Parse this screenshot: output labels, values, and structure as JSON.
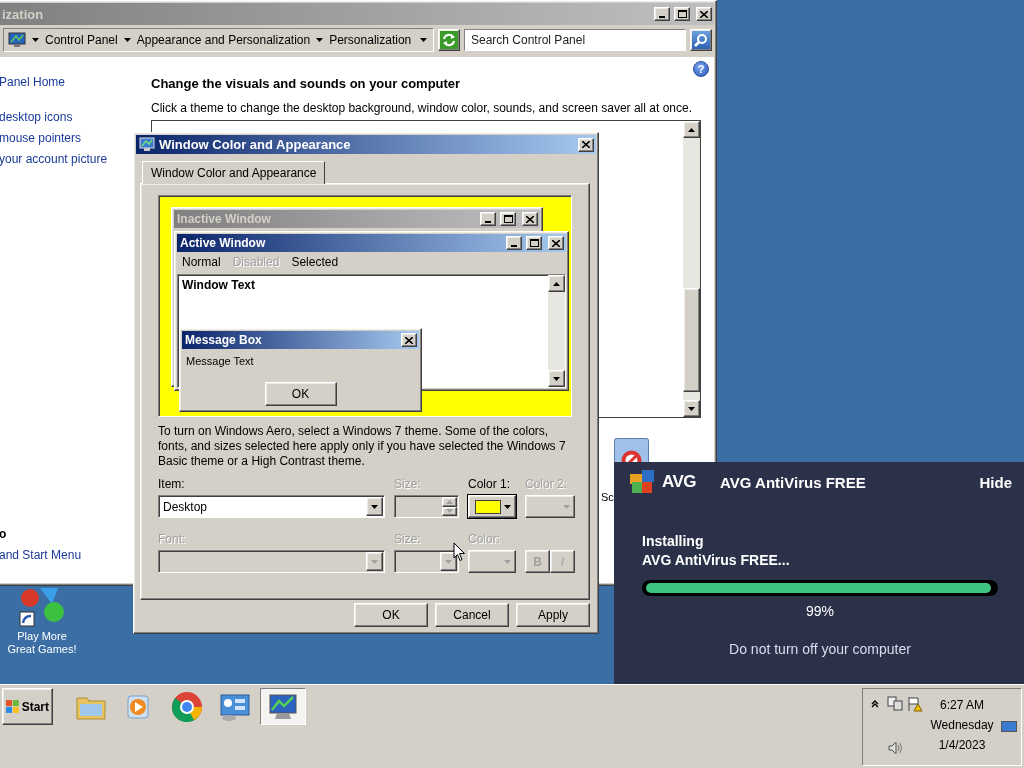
{
  "control_panel": {
    "title": "ization",
    "breadcrumbs": [
      "Control Panel",
      "Appearance and Personalization",
      "Personalization"
    ],
    "search": {
      "placeholder": "Search Control Panel"
    },
    "help": "?",
    "tasks": [
      {
        "label": "Panel Home",
        "kind": "home"
      },
      {
        "label": "desktop icons",
        "kind": "task"
      },
      {
        "label": "mouse pointers",
        "kind": "task"
      },
      {
        "label": "your account picture",
        "kind": "task"
      }
    ],
    "see_also": {
      "title": "o",
      "links": [
        "and Start Menu"
      ]
    },
    "heading": "Change the visuals and sounds on your computer",
    "description": "Click a theme to change the desktop background, window color, sounds, and screen saver all at once.",
    "screen_saver_label": "Sc"
  },
  "dialog": {
    "title": "Window Color and Appearance",
    "tabs": [
      {
        "label": "Window Color and Appearance",
        "selected": true
      }
    ],
    "preview": {
      "inactive_title": "Inactive Window",
      "active_title": "Active Window",
      "menu": [
        {
          "label": "Normal",
          "disabled": false
        },
        {
          "label": "Disabled",
          "disabled": true
        },
        {
          "label": "Selected",
          "disabled": false
        }
      ],
      "window_text": "Window Text",
      "message_box": {
        "title": "Message Box",
        "text": "Message Text",
        "button": "OK"
      }
    },
    "note": "To turn on Windows Aero, select a Windows 7 theme.  Some of the colors, fonts, and sizes selected here apply only if you have selected the Windows 7 Basic theme or a High Contrast theme.",
    "rows": [
      [
        {
          "label": "Item:",
          "kind": "select",
          "value": "Desktop",
          "disabled": false
        },
        {
          "label": "Size:",
          "kind": "spinner",
          "disabled": true
        },
        {
          "label": "Color 1:",
          "kind": "color",
          "disabled": false,
          "color": "#ffff00"
        },
        {
          "label": "Color 2:",
          "kind": "color",
          "disabled": true
        }
      ],
      [
        {
          "label": "Font:",
          "kind": "select",
          "disabled": true
        },
        {
          "label": "Size:",
          "kind": "select",
          "disabled": true
        },
        {
          "label": "Color:",
          "kind": "color",
          "disabled": true
        },
        {
          "kind": "style",
          "buttons": [
            "B",
            "I"
          ],
          "disabled": true
        }
      ]
    ],
    "buttons": [
      "OK",
      "Cancel",
      "Apply"
    ]
  },
  "avg": {
    "logo_text": "AVG",
    "title": "AVG AntiVirus FREE",
    "hide": "Hide",
    "status": [
      "Installing",
      "AVG AntiVirus FREE..."
    ],
    "progress": {
      "level": 0.99
    },
    "percent": "99%",
    "note": "Do not turn off your computer"
  },
  "desktop_icons": [
    {
      "label": "Play More Great Games!"
    }
  ],
  "taskbar": {
    "start": "Start",
    "apps": [
      {
        "kind": "folder",
        "selected": false
      },
      {
        "kind": "media",
        "selected": false
      },
      {
        "kind": "browser",
        "selected": false
      },
      {
        "kind": "dashboard",
        "selected": false
      },
      {
        "kind": "display",
        "selected": true
      }
    ],
    "clock": {
      "time": "6:27 AM",
      "day": "Wednesday",
      "date": "1/4/2023"
    }
  }
}
